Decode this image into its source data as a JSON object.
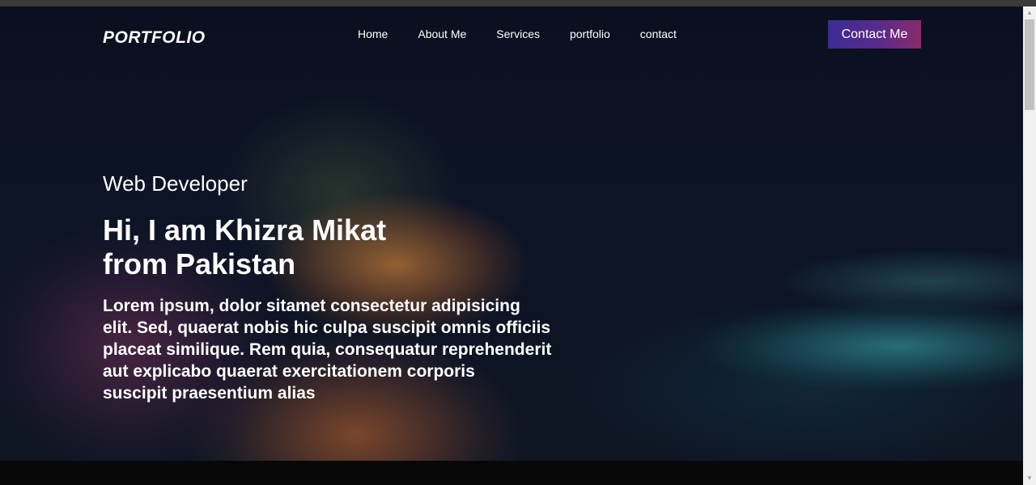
{
  "brand": {
    "logo": "PORTFOLIO"
  },
  "nav": {
    "items": [
      {
        "label": "Home"
      },
      {
        "label": "About Me"
      },
      {
        "label": "Services"
      },
      {
        "label": "portfolio"
      },
      {
        "label": "contact"
      }
    ],
    "cta_label": "Contact Me"
  },
  "hero": {
    "role": "Web Developer",
    "headline_lines": [
      "Hi, I am Khizra Mikat",
      "from Pakistan"
    ],
    "intro_lines": [
      "Lorem ipsum, dolor sitamet consectetur adipisicing",
      "elit. Sed, quaerat nobis hic culpa suscipit omnis officiis",
      "placeat similique. Rem quia, consequatur reprehenderit",
      "aut explicabo quaerat exercitationem corporis",
      "suscipit praesentium alias"
    ]
  },
  "colors": {
    "cta_gradient_start": "#3b2c93",
    "cta_gradient_end": "#8a2a6a",
    "text": "#ffffff",
    "background": "#0b1020"
  },
  "icons": {
    "scroll_up": "arrow-up-icon",
    "scroll_down": "arrow-down-icon"
  }
}
